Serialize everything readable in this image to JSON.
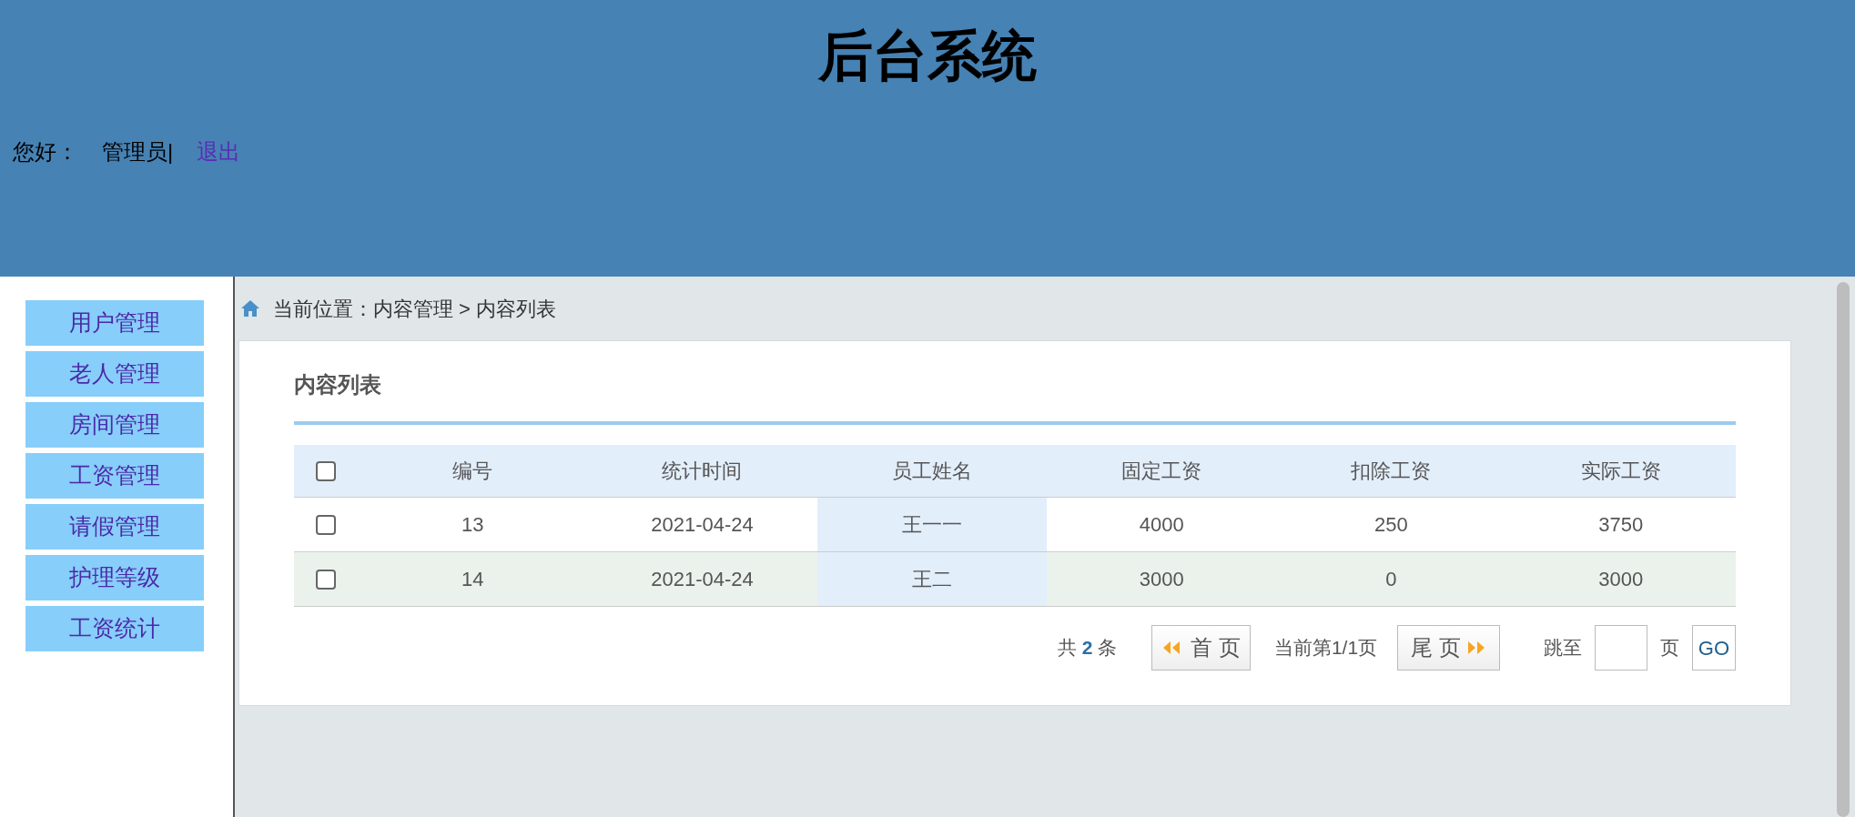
{
  "header": {
    "title": "后台系统",
    "greeting": "您好：",
    "user": "管理员|",
    "logout": "退出"
  },
  "sidebar": {
    "items": [
      {
        "label": "用户管理",
        "selected": false
      },
      {
        "label": "老人管理",
        "selected": false
      },
      {
        "label": "房间管理",
        "selected": false
      },
      {
        "label": "工资管理",
        "selected": false
      },
      {
        "label": "请假管理",
        "selected": false
      },
      {
        "label": "护理等级",
        "selected": false
      },
      {
        "label": "工资统计",
        "selected": false
      }
    ]
  },
  "breadcrumb": "当前位置：内容管理 > 内容列表",
  "panel": {
    "title": "内容列表",
    "table": {
      "select_all": {
        "checked": false
      },
      "columns": [
        "编号",
        "统计时间",
        "员工姓名",
        "固定工资",
        "扣除工资",
        "实际工资"
      ],
      "rows": [
        {
          "checked": false,
          "striped": false,
          "cells": [
            {
              "text": "13",
              "highlighted": false
            },
            {
              "text": "2021-04-24",
              "highlighted": false
            },
            {
              "text": "王一一",
              "highlighted": true
            },
            {
              "text": "4000",
              "highlighted": false
            },
            {
              "text": "250",
              "highlighted": false
            },
            {
              "text": "3750",
              "highlighted": false
            }
          ]
        },
        {
          "checked": false,
          "striped": true,
          "cells": [
            {
              "text": "14",
              "highlighted": false
            },
            {
              "text": "2021-04-24",
              "highlighted": false
            },
            {
              "text": "王二",
              "highlighted": true
            },
            {
              "text": "3000",
              "highlighted": false
            },
            {
              "text": "0",
              "highlighted": false
            },
            {
              "text": "3000",
              "highlighted": false
            }
          ]
        }
      ]
    },
    "pagination": {
      "total_prefix": "共",
      "total": "2",
      "total_suffix": "条",
      "first": "首 页",
      "current": "当前第1/1页",
      "last": "尾 页",
      "jump_label": "跳至",
      "jump_unit": "页",
      "go": "GO"
    }
  }
}
